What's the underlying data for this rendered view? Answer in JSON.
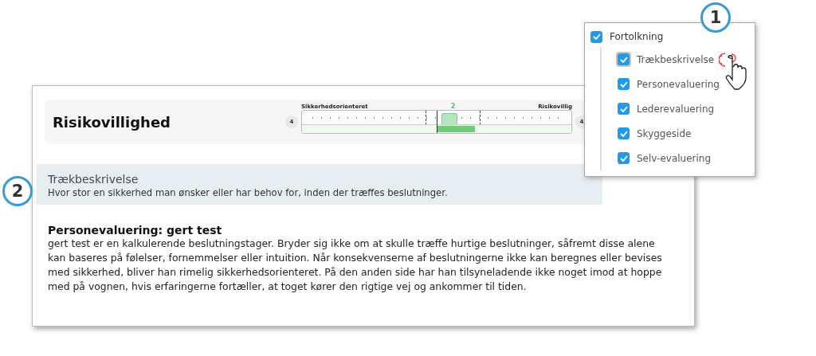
{
  "section": {
    "title": "Risikovillighed",
    "scale": {
      "left_badge": "4",
      "right_badge": "4",
      "left_label": "Sikkerhedsorienteret",
      "right_label": "Risikovillig",
      "value": "2"
    }
  },
  "trait": {
    "title": "Trækbeskrivelse",
    "description": "Hvor stor en sikkerhed man ønsker eller har behov for, inden der træffes beslutninger."
  },
  "person": {
    "title": "Personevaluering: gert test",
    "text": "gert test er en kalkulerende beslutningstager. Bryder sig ikke om at skulle træffe hurtige beslutninger, såfremt disse alene kan baseres på følelser, fornemmelser eller intuition. Når konsekvenserne af beslutningerne ikke kan beregnes eller bevises med sikkerhed, bliver han rimelig sikkerhedsorienteret. På den anden side har han tilsyneladende ikke noget imod at hoppe med på vognen, hvis erfaringerne fortæller, at toget kører den rigtige vej og ankommer til tiden."
  },
  "filter": {
    "label": "Fortolkning",
    "checked": true,
    "items": [
      {
        "label": "Trækbeskrivelse",
        "checked": true,
        "focused": true
      },
      {
        "label": "Personevaluering",
        "checked": true,
        "focused": false
      },
      {
        "label": "Lederevaluering",
        "checked": true,
        "focused": false
      },
      {
        "label": "Skyggeside",
        "checked": true,
        "focused": false
      },
      {
        "label": "Selv-evaluering",
        "checked": true,
        "focused": false
      }
    ]
  },
  "callouts": [
    {
      "label": "1"
    },
    {
      "label": "2"
    }
  ]
}
